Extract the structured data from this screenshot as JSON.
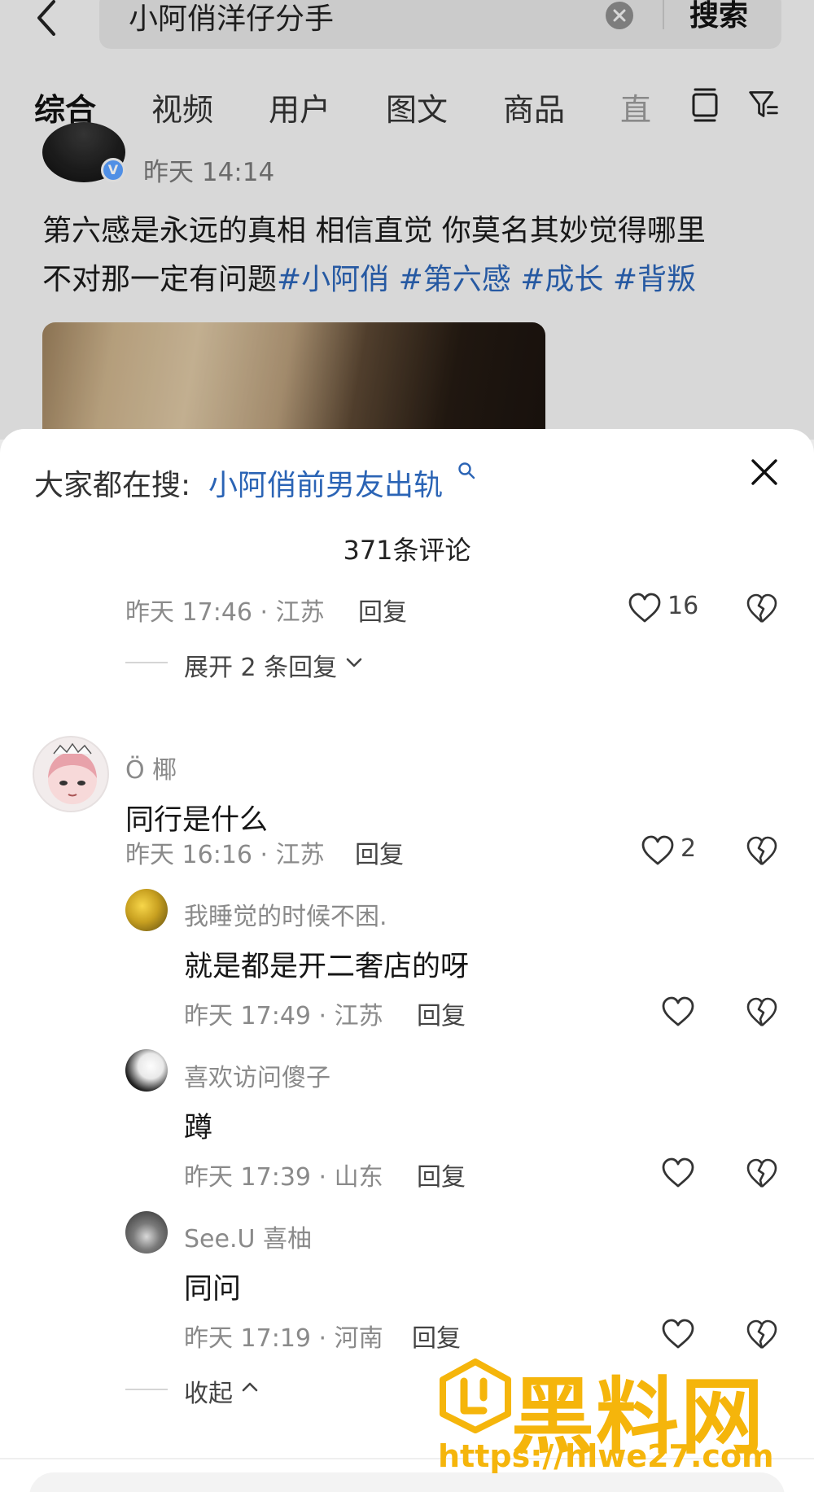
{
  "search": {
    "query": "小阿俏洋仔分手",
    "button_label": "搜索"
  },
  "tabs": [
    {
      "label": "综合"
    },
    {
      "label": "视频"
    },
    {
      "label": "用户"
    },
    {
      "label": "图文"
    },
    {
      "label": "商品"
    },
    {
      "label": "直"
    }
  ],
  "post": {
    "time": "昨天 14:14",
    "text_line1": "第六感是永远的真相 相信直觉 你莫名其妙觉得哪里",
    "text_line2_prefix": "不对那一定有问题",
    "hashtags": [
      "#小阿俏",
      "#第六感",
      "#成长",
      "#背叛"
    ]
  },
  "sheet": {
    "trend_label": "大家都在搜:",
    "trend_query": "小阿俏前男友出轨",
    "comment_count": "371条评论"
  },
  "comments": {
    "top_partial": {
      "meta": "昨天 17:46 · 江苏",
      "reply": "回复",
      "likes": "16",
      "expand": "展开 2 条回复"
    },
    "main": {
      "username": "Ö 椰",
      "content": "同行是什么",
      "meta": "昨天 16:16 · 江苏",
      "reply": "回复",
      "likes": "2"
    },
    "replies": [
      {
        "username": "我睡觉的时候不困.",
        "content": "就是都是开二奢店的呀",
        "meta": "昨天 17:49 · 江苏",
        "reply": "回复"
      },
      {
        "username": "喜欢访问傻子",
        "content": "蹲",
        "meta": "昨天 17:39 · 山东",
        "reply": "回复"
      },
      {
        "username": "See.U 喜柚",
        "content": "同问",
        "meta": "昨天 17:19 · 河南",
        "reply": "回复"
      }
    ],
    "collapse": "收起"
  },
  "watermark": {
    "title": "黑料网",
    "url": "https://hlwe27.com"
  },
  "colors": {
    "link_blue": "#2b64b5",
    "watermark_orange": "#f5b50b"
  },
  "icons": [
    "back-icon",
    "clear-icon",
    "layout-icon",
    "filter-icon",
    "search-icon",
    "close-icon",
    "heart-icon",
    "broken-heart-icon",
    "chevron-down-icon",
    "chevron-up-icon"
  ]
}
